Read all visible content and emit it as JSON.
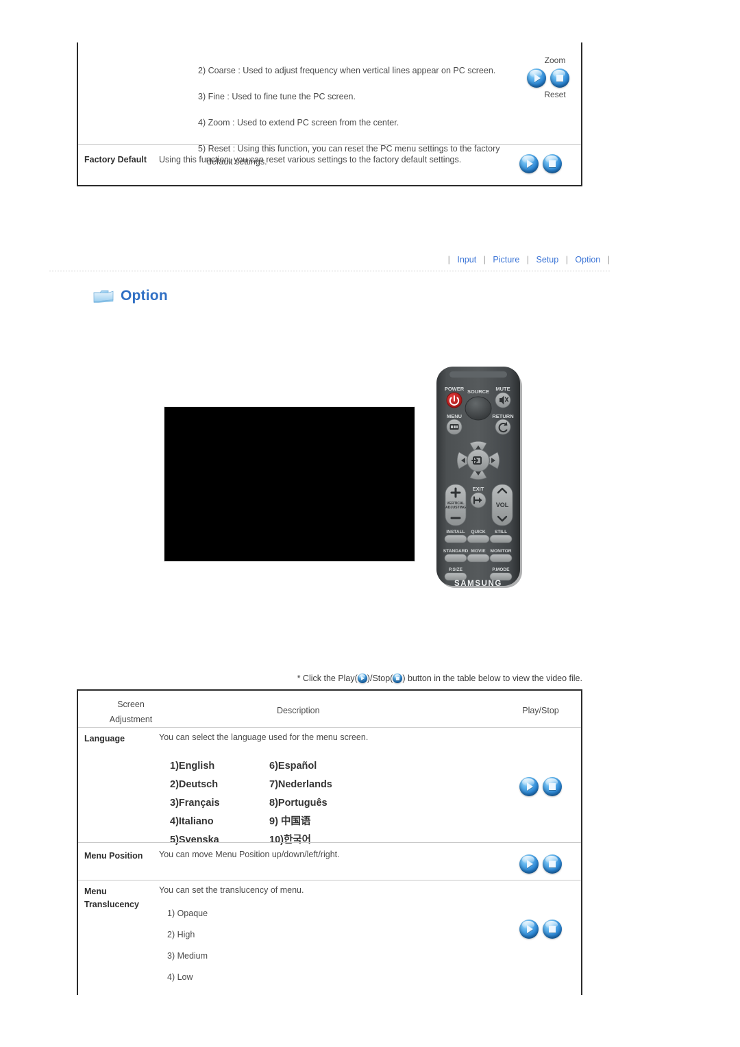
{
  "top_table": {
    "pc_items": [
      "2) Coarse : Used to adjust frequency when vertical lines appear on PC screen.",
      "3) Fine : Used to fine tune the PC screen.",
      "4) Zoom : Used to extend PC screen from the center.",
      "5) Reset : Using this function, you can reset the PC menu settings to the factory default settings."
    ],
    "zoom_label": "Zoom",
    "reset_label": "Reset",
    "factory_default_label": "Factory Default",
    "factory_default_desc": "Using this function, you can reset various settings to the factory default settings."
  },
  "nav": {
    "items": [
      {
        "label": "Input"
      },
      {
        "label": "Picture"
      },
      {
        "label": "Setup"
      },
      {
        "label": "Option"
      }
    ],
    "separator": "|"
  },
  "section": {
    "title": "Option",
    "icon": "folder-icon",
    "accent_color": "#2f6fc4"
  },
  "media": {
    "screen_alt": "menu-screen-preview",
    "remote": {
      "brand": "SAMSUNG",
      "buttons": [
        "POWER",
        "SOURCE",
        "MUTE",
        "MENU",
        "RETURN",
        "EXIT",
        "VOL",
        "VERTICAL ADJUSTING",
        "INSTALL",
        "QUICK",
        "STILL",
        "STANDARD",
        "MOVIE",
        "MONITOR",
        "P.SIZE",
        "P.MODE"
      ]
    }
  },
  "note": {
    "prefix": "* Click the Play(",
    "middle": ")/Stop(",
    "suffix": ") button in the table below to view the video file."
  },
  "bottom_table": {
    "headers": {
      "screen": "Screen",
      "adjustment": "Adjustment",
      "description": "Description",
      "play_stop": "Play/Stop"
    },
    "rows": [
      {
        "label": "Language",
        "label2": "",
        "description": "You can select the language used for the menu screen."
      },
      {
        "label": "Menu Position",
        "label2": "",
        "description": "You can move Menu Position up/down/left/right."
      },
      {
        "label": "Menu",
        "label2": "Translucency",
        "description": "You can set the translucency of menu."
      }
    ],
    "languages_left": [
      "1)English",
      "2)Deutsch",
      "3)Français",
      "4)Italiano",
      "5)Svenska"
    ],
    "languages_right": [
      "6)Español",
      "7)Nederlands",
      "8)Português",
      "9) 中国语",
      "10)한국어"
    ],
    "translucency_options": [
      "1) Opaque",
      "2) High",
      "3) Medium",
      "4) Low"
    ]
  },
  "icons": {
    "play": "play-icon",
    "stop": "stop-icon"
  }
}
